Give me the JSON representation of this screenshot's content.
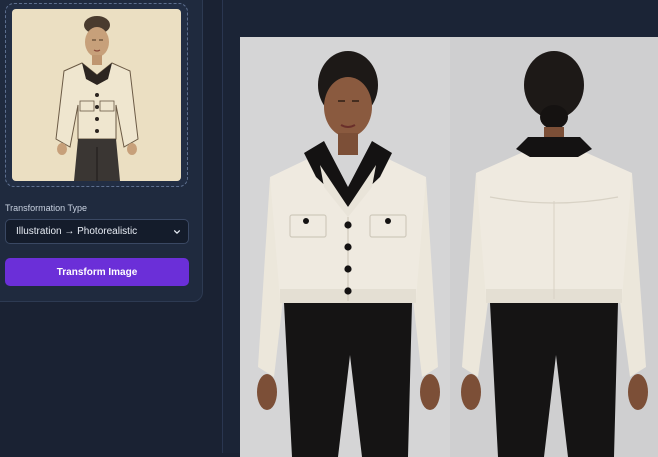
{
  "controls": {
    "transformation_label": "Transformation Type",
    "transformation_value": "Illustration → Photorealistic",
    "transform_button": "Transform Image"
  },
  "images": {
    "input": "pencil-sketch-woman-cream-cropped-jacket-black-collar",
    "output": "photo-woman-cream-cropped-jacket-front-and-back-views"
  }
}
